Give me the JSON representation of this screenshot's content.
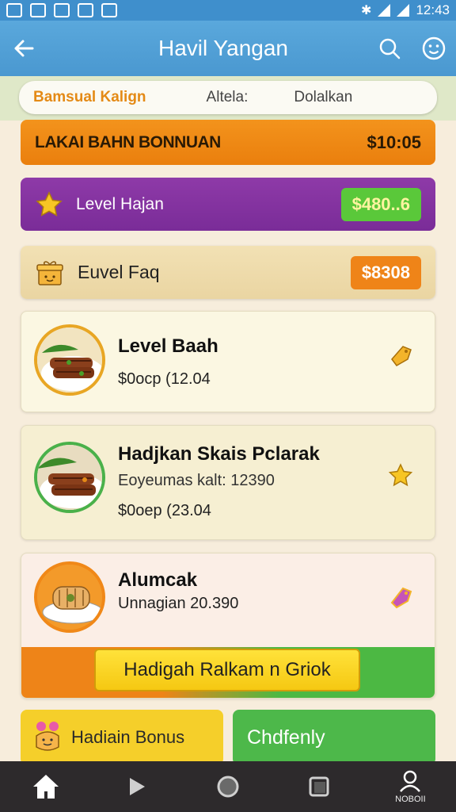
{
  "status_bar": {
    "time": "12:43"
  },
  "app_bar": {
    "title": "Havil Yangan",
    "back_icon": "arrow-left-icon",
    "search_icon": "search-icon",
    "menu_icon": "smiley-icon"
  },
  "tabs": [
    {
      "label": "Bamsual Kalign"
    },
    {
      "label": "Altela:"
    },
    {
      "label": "Dolalkan"
    }
  ],
  "promo": {
    "label": "LAKAI BAHN BONNUAN",
    "amount": "$10:05"
  },
  "level_card": {
    "label": "Level Hajan",
    "badge": "$480..6"
  },
  "fav_card": {
    "label": "Euvel Faq",
    "badge": "$8308"
  },
  "food_items": [
    {
      "title": "Level Baah",
      "lines": [
        "$0ocp (12.04"
      ]
    },
    {
      "title": "Hadjkan Skais Pclarak",
      "lines": [
        "Eoyeumas kalt: 12390",
        "$0oep (23.04"
      ]
    },
    {
      "title": "Alumcak",
      "lines": [
        "Unnagian 20.390"
      ]
    }
  ],
  "banner": {
    "label": "Hadigah Ralkam n Griok"
  },
  "bonus_button": {
    "label": "Hadiain Bonus"
  },
  "green_button": {
    "label": "Chdfenly"
  },
  "bottom_nav": [
    {
      "icon": "home-icon"
    },
    {
      "icon": "play-icon"
    },
    {
      "icon": "circle-icon"
    },
    {
      "icon": "square-icon"
    },
    {
      "icon": "profile-icon",
      "label": "NOBOII"
    }
  ],
  "colors": {
    "app_bar": "#4a98d0",
    "orange": "#ea7f0d",
    "purple": "#7a2c98",
    "green": "#4db84a",
    "yellow": "#f5cf2a"
  }
}
